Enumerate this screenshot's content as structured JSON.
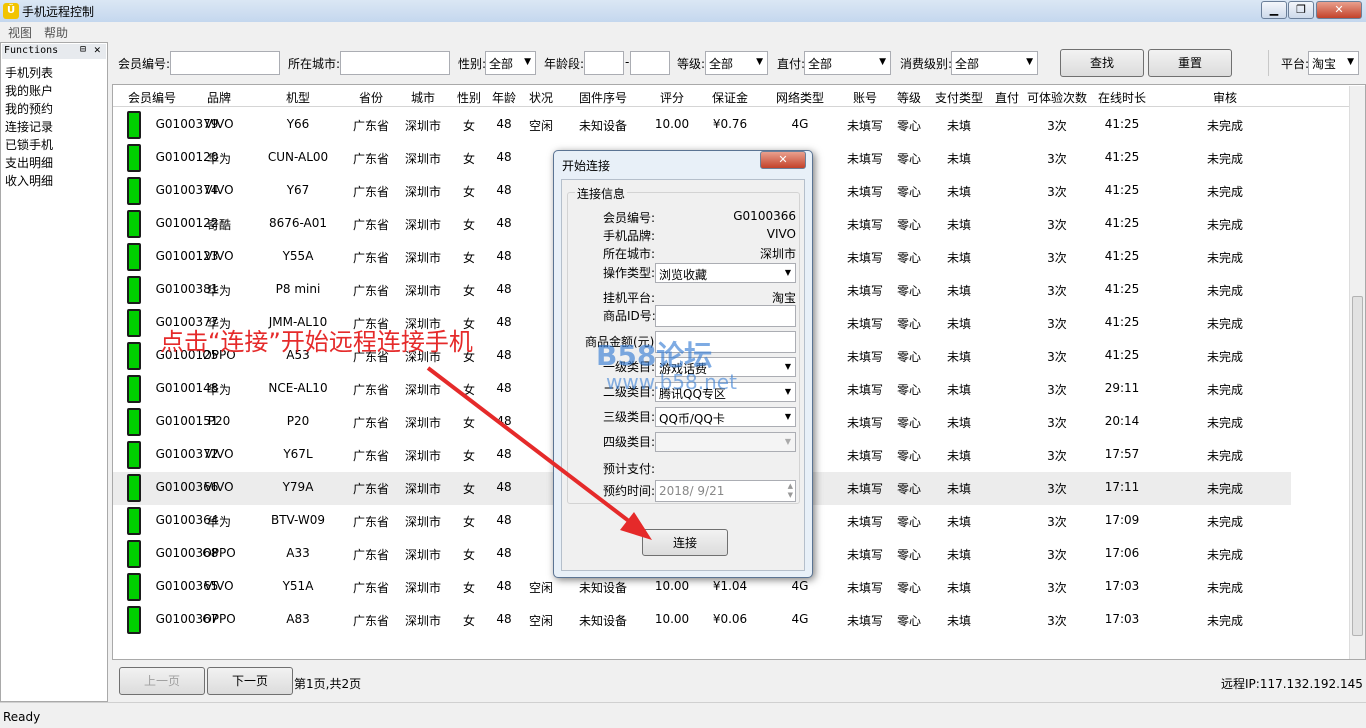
{
  "window": {
    "title": "手机远程控制",
    "icon": "app-icon",
    "controls": [
      "minimize",
      "maximize",
      "close"
    ]
  },
  "menu": [
    "视图",
    "帮助"
  ],
  "sidebar": {
    "title": "Functions",
    "items": [
      "手机列表",
      "我的账户",
      "我的预约",
      "连接记录",
      "已锁手机",
      "支出明细",
      "收入明细"
    ]
  },
  "toolbar": {
    "member_label": "会员编号:",
    "member_value": "",
    "city_label": "所在城市:",
    "city_value": "",
    "gender_label": "性别:",
    "gender_value": "全部",
    "age_label": "年龄段:",
    "age_dash": "-",
    "age_from": "",
    "age_to": "",
    "level_label": "等级:",
    "level_value": "全部",
    "direct_label": "直付:",
    "direct_value": "全部",
    "consume_label": "消费级别:",
    "consume_value": "全部",
    "search_label": "查找",
    "reset_label": "重置",
    "platform_label": "平台:",
    "platform_value": "淘宝"
  },
  "table": {
    "columns": [
      "会员编号",
      "品牌",
      "机型",
      "省份",
      "城市",
      "性别",
      "年龄",
      "状况",
      "固件序号",
      "评分",
      "保证金",
      "网络类型",
      "账号",
      "等级",
      "支付类型",
      "直付",
      "可体验次数",
      "在线时长",
      "审核"
    ],
    "rows": [
      [
        "G0100379",
        "VIVO",
        "Y66",
        "广东省",
        "深圳市",
        "女",
        "48",
        "空闲",
        "未知设备",
        "10.00",
        "¥0.76",
        "4G",
        "未填写",
        "零心",
        "未填",
        "",
        "3次",
        "41:25",
        "未完成"
      ],
      [
        "G0100120",
        "华为",
        "CUN-AL00",
        "广东省",
        "深圳市",
        "女",
        "48",
        "",
        "",
        "",
        "",
        "",
        "未填写",
        "零心",
        "未填",
        "",
        "3次",
        "41:25",
        "未完成"
      ],
      [
        "G0100374",
        "VIVO",
        "Y67",
        "广东省",
        "深圳市",
        "女",
        "48",
        "",
        "",
        "",
        "",
        "",
        "未填写",
        "零心",
        "未填",
        "",
        "3次",
        "41:25",
        "未完成"
      ],
      [
        "G0100122",
        "奇酷",
        "8676-A01",
        "广东省",
        "深圳市",
        "女",
        "48",
        "",
        "",
        "",
        "",
        "",
        "未填写",
        "零心",
        "未填",
        "",
        "3次",
        "41:25",
        "未完成"
      ],
      [
        "G0100123",
        "VIVO",
        "Y55A",
        "广东省",
        "深圳市",
        "女",
        "48",
        "",
        "",
        "",
        "",
        "",
        "未填写",
        "零心",
        "未填",
        "",
        "3次",
        "41:25",
        "未完成"
      ],
      [
        "G0100381",
        "华为",
        "P8 mini",
        "广东省",
        "深圳市",
        "女",
        "48",
        "",
        "",
        "",
        "",
        "",
        "未填写",
        "零心",
        "未填",
        "",
        "3次",
        "41:25",
        "未完成"
      ],
      [
        "G0100377",
        "华为",
        "JMM-AL10",
        "广东省",
        "深圳市",
        "女",
        "48",
        "",
        "",
        "",
        "",
        "",
        "未填写",
        "零心",
        "未填",
        "",
        "3次",
        "41:25",
        "未完成"
      ],
      [
        "G0100125",
        "OPPO",
        "A53",
        "广东省",
        "深圳市",
        "女",
        "48",
        "",
        "",
        "",
        "",
        "",
        "未填写",
        "零心",
        "未填",
        "",
        "3次",
        "41:25",
        "未完成"
      ],
      [
        "G0100148",
        "华为",
        "NCE-AL10",
        "广东省",
        "深圳市",
        "女",
        "48",
        "",
        "",
        "",
        "",
        "",
        "未填写",
        "零心",
        "未填",
        "",
        "3次",
        "29:11",
        "未完成"
      ],
      [
        "G0100151",
        "P20",
        "P20",
        "广东省",
        "深圳市",
        "女",
        "48",
        "",
        "",
        "",
        "",
        "",
        "未填写",
        "零心",
        "未填",
        "",
        "3次",
        "20:14",
        "未完成"
      ],
      [
        "G0100372",
        "VIVO",
        "Y67L",
        "广东省",
        "深圳市",
        "女",
        "48",
        "",
        "",
        "",
        "",
        "",
        "未填写",
        "零心",
        "未填",
        "",
        "3次",
        "17:57",
        "未完成"
      ],
      [
        "G0100366",
        "VIVO",
        "Y79A",
        "广东省",
        "深圳市",
        "女",
        "48",
        "",
        "",
        "",
        "",
        "",
        "未填写",
        "零心",
        "未填",
        "",
        "3次",
        "17:11",
        "未完成"
      ],
      [
        "G0100364",
        "华为",
        "BTV-W09",
        "广东省",
        "深圳市",
        "女",
        "48",
        "",
        "",
        "",
        "",
        "",
        "未填写",
        "零心",
        "未填",
        "",
        "3次",
        "17:09",
        "未完成"
      ],
      [
        "G0100368",
        "OPPO",
        "A33",
        "广东省",
        "深圳市",
        "女",
        "48",
        "",
        "",
        "",
        "",
        "",
        "未填写",
        "零心",
        "未填",
        "",
        "3次",
        "17:06",
        "未完成"
      ],
      [
        "G0100365",
        "VIVO",
        "Y51A",
        "广东省",
        "深圳市",
        "女",
        "48",
        "空闲",
        "未知设备",
        "10.00",
        "¥1.04",
        "4G",
        "未填写",
        "零心",
        "未填",
        "",
        "3次",
        "17:03",
        "未完成"
      ],
      [
        "G0100367",
        "OPPO",
        "A83",
        "广东省",
        "深圳市",
        "女",
        "48",
        "空闲",
        "未知设备",
        "10.00",
        "¥0.06",
        "4G",
        "未填写",
        "零心",
        "未填",
        "",
        "3次",
        "17:03",
        "未完成"
      ]
    ],
    "selected_row": 11
  },
  "footer": {
    "prev": "上一页",
    "next": "下一页",
    "page_info": "第1页,共2页",
    "remote_ip": "远程IP:117.132.192.145"
  },
  "status": "Ready",
  "dialog": {
    "title": "开始连接",
    "group": "连接信息",
    "member_label": "会员编号:",
    "member_value": "G0100366",
    "brand_label": "手机品牌:",
    "brand_value": "VIVO",
    "city_label": "所在城市:",
    "city_value": "深圳市",
    "op_label": "操作类型:",
    "op_value": "浏览收藏",
    "platform_label": "挂机平台:",
    "platform_value": "淘宝",
    "product_id_label": "商品ID号:",
    "product_id_value": "",
    "amount_label": "商品金额(元):",
    "amount_value": "",
    "cat1_label": "一级类目:",
    "cat1_value": "游戏话费",
    "cat2_label": "二级类目:",
    "cat2_value": "腾讯QQ专区",
    "cat3_label": "三级类目:",
    "cat3_value": "QQ币/QQ卡",
    "cat4_label": "四级类目:",
    "cat4_value": "",
    "pay_label": "预计支付:",
    "pay_value": "",
    "time_label": "预约时间:",
    "time_value": "2018/  9/21",
    "connect_label": "连接"
  },
  "annotation": {
    "text": "点击“连接”开始远程连接手机",
    "color": "#e52a2a"
  },
  "watermark": {
    "text": "B58论坛",
    "url": "www.b58.net"
  }
}
